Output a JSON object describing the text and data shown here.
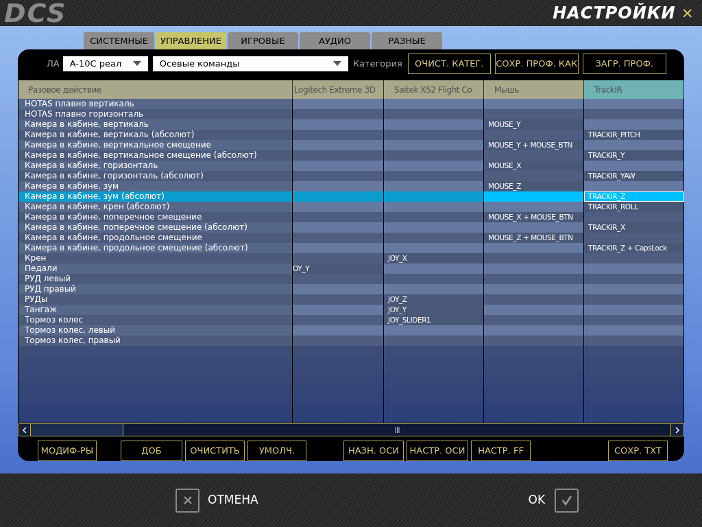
{
  "header": {
    "logo": "DCS",
    "title": "НАСТРОЙКИ",
    "close": "×"
  },
  "tabs": [
    {
      "label": "СИСТЕМНЫЕ",
      "selected": false
    },
    {
      "label": "УПРАВЛЕНИЕ",
      "selected": true
    },
    {
      "label": "ИГРОВЫЕ",
      "selected": false
    },
    {
      "label": "АУДИО",
      "selected": false
    },
    {
      "label": "РАЗНЫЕ",
      "selected": false
    }
  ],
  "toolbar": {
    "aircraft_label": "ЛА",
    "aircraft": "A-10C реал",
    "category": "Осевые команды",
    "category_label": "Категория",
    "buttons": [
      "ОЧИСТ. КАТЕГ.",
      "СОХР. ПРОФ. КАК",
      "ЗАГР. ПРОФ."
    ]
  },
  "table": {
    "columns": [
      {
        "label": "Разовое действие",
        "selected": false
      },
      {
        "label": "Logitech Extreme 3D",
        "selected": false
      },
      {
        "label": "Saitek X52 Flight Co",
        "selected": false
      },
      {
        "label": "Мышь",
        "selected": false
      },
      {
        "label": "TrackIR",
        "selected": true
      }
    ],
    "rows": [
      {
        "action": "HOTAS плавно вертикаль",
        "selected": false
      },
      {
        "action": "HOTAS плавно горизонталь",
        "selected": false
      },
      {
        "action": "Камера в кабине, вертикаль",
        "mouse": "MOUSE_Y",
        "selected": false
      },
      {
        "action": "Камера в кабине, вертикаль (абсолют)",
        "trackir": "TRACKIR_PITCH",
        "selected": false
      },
      {
        "action": "Камера в кабине, вертикальное смещение",
        "mouse": "MOUSE_Y + MOUSE_BTN",
        "selected": false
      },
      {
        "action": "Камера в кабине, вертикальное смещение (абсолют)",
        "trackir": "TRACKIR_Y",
        "selected": false
      },
      {
        "action": "Камера в кабине, горизонталь",
        "mouse": "MOUSE_X",
        "selected": false
      },
      {
        "action": "Камера в кабине, горизонталь (абсолют)",
        "trackir": "TRACKIR_YAW",
        "selected": false
      },
      {
        "action": "Камера в кабине, зум",
        "mouse": "MOUSE_Z",
        "selected": false
      },
      {
        "action": "Камера в кабине, зум (абсолют)",
        "trackir": "TRACKIR_Z",
        "selected": true
      },
      {
        "action": "Камера в кабине, крен (абсолют)",
        "trackir": "TRACKIR_ROLL",
        "selected": false
      },
      {
        "action": "Камера в кабине, поперечное смещение",
        "mouse": "MOUSE_X + MOUSE_BTN",
        "selected": false
      },
      {
        "action": "Камера в кабине, поперечное смещение (абсолют)",
        "trackir": "TRACKIR_X",
        "selected": false
      },
      {
        "action": "Камера в кабине, продольное смещение",
        "mouse": "MOUSE_Z + MOUSE_BTN",
        "selected": false
      },
      {
        "action": "Камера в кабине, продольное смещение (абсолют)",
        "trackir": "TRACKIR_Z + CapsLock",
        "selected": false
      },
      {
        "action": "Крен",
        "saitek": "JOY_X",
        "selected": false
      },
      {
        "action": "Педали",
        "logitech": "OY_Y",
        "selected": false
      },
      {
        "action": "РУД левый",
        "selected": false
      },
      {
        "action": "РУД правый",
        "selected": false
      },
      {
        "action": "РУДы",
        "saitek": "JOY_Z",
        "selected": false
      },
      {
        "action": "Тангаж",
        "saitek": "JOY_Y",
        "selected": false
      },
      {
        "action": "Тормоз колес",
        "saitek": "JOY_SLIDER1",
        "selected": false
      },
      {
        "action": "Тормоз колес, левый",
        "selected": false
      },
      {
        "action": "Тормоз колес, правый",
        "selected": false
      }
    ]
  },
  "bottom_buttons": [
    [
      "МОДИФ-РЫ"
    ],
    [
      "ДОБ",
      "ОЧИСТИТЬ",
      "УМОЛЧ."
    ],
    [
      "НАЗН. ОСИ",
      "НАСТР. ОСИ",
      "НАСТР. FF"
    ],
    [
      "СОХР. TXT"
    ]
  ],
  "footer": {
    "cancel": "ОТМЕНА",
    "ok": "OK"
  }
}
